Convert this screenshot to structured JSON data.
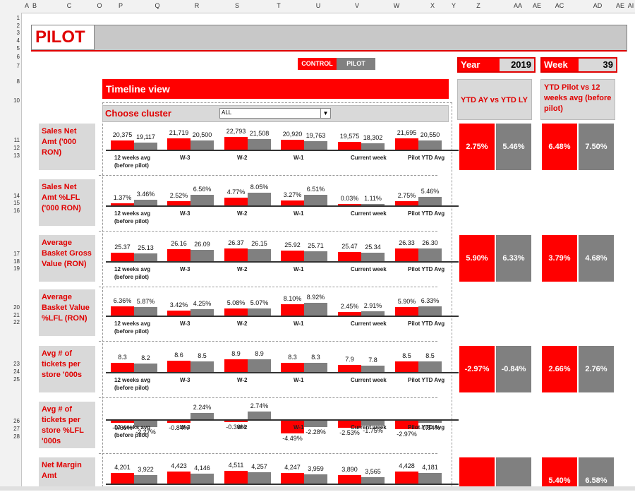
{
  "columns": [
    "A",
    "B",
    "C",
    "O",
    "P",
    "Q",
    "R",
    "S",
    "T",
    "U",
    "V",
    "W",
    "X",
    "Y",
    "Z",
    "AA",
    "AE",
    "AC",
    "AD",
    "AE",
    "AI"
  ],
  "rows": [
    "1",
    "2",
    "3",
    "4",
    "5",
    "6",
    "7",
    "8",
    "",
    "10",
    "11",
    "12",
    "13",
    "14",
    "15",
    "16",
    "17",
    "18",
    "19",
    "20",
    "21",
    "22",
    "23",
    "24",
    "25",
    "26",
    "27",
    "28"
  ],
  "title": "PILOT",
  "toggle": {
    "control": "CONTROL",
    "pilot": "PILOT"
  },
  "year": {
    "label": "Year",
    "value": "2019"
  },
  "week": {
    "label": "Week",
    "value": "39"
  },
  "timeline_title": "Timeline view",
  "cluster": {
    "label": "Choose cluster",
    "value": "ALL"
  },
  "ytd_headers": {
    "ay": "YTD AY vs YTD LY",
    "pilot": "YTD Pilot vs 12 weeks avg (before pilot)"
  },
  "colors": {
    "red": "#ff0000",
    "grey": "#808080"
  },
  "categories": [
    "12 weeks avg (before pilot)",
    "W-3",
    "W-2",
    "W-1",
    "Current week",
    "Pilot YTD Avg"
  ],
  "metrics": [
    {
      "label": "Sales Net Amt ('000 RON)",
      "control": [
        "20,375",
        "21,719",
        "22,793",
        "20,920",
        "19,575",
        "21,695"
      ],
      "pilot": [
        "19,117",
        "20,500",
        "21,508",
        "19,763",
        "18,302",
        "20,550"
      ],
      "kpi": [
        "2.75%",
        "5.46%",
        "6.48%",
        "7.50%"
      ]
    },
    {
      "label": "Sales Net Amt %LFL ('000 RON)",
      "control": [
        "1.37%",
        "2.52%",
        "4.77%",
        "3.27%",
        "0.03%",
        "2.75%"
      ],
      "pilot": [
        "3.46%",
        "6.56%",
        "8.05%",
        "6.51%",
        "1.11%",
        "5.46%"
      ]
    },
    {
      "label": "Average Basket Gross Value (RON)",
      "control": [
        "25.37",
        "26.16",
        "26.37",
        "25.92",
        "25.47",
        "26.33"
      ],
      "pilot": [
        "25.13",
        "26.09",
        "26.15",
        "25.71",
        "25.34",
        "26.30"
      ],
      "kpi": [
        "5.90%",
        "6.33%",
        "3.79%",
        "4.68%"
      ]
    },
    {
      "label": "Average Basket Value %LFL (RON)",
      "control": [
        "6.36%",
        "3.42%",
        "5.08%",
        "8.10%",
        "2.45%",
        "5.90%"
      ],
      "pilot": [
        "5.87%",
        "4.25%",
        "5.07%",
        "8.92%",
        "2.91%",
        "6.33%"
      ]
    },
    {
      "label": "Avg # of tickets per store '000s",
      "control": [
        "8.3",
        "8.6",
        "8.9",
        "8.3",
        "7.9",
        "8.5"
      ],
      "pilot": [
        "8.2",
        "8.5",
        "8.9",
        "8.3",
        "7.8",
        "8.5"
      ],
      "kpi": [
        "-2.97%",
        "-0.84%",
        "2.66%",
        "2.76%"
      ]
    },
    {
      "label": "Avg # of tickets per store %LFL '000s",
      "control": [
        "-0.69%",
        "-0.84%",
        "-0.36%",
        "-4.49%",
        "-2.53%",
        "-2.97%"
      ],
      "pilot": [
        "-2.27%",
        "2.24%",
        "2.74%",
        "-2.28%",
        "-1.75%",
        "-0.84%"
      ]
    },
    {
      "label": "Net Margin Amt",
      "control": [
        "4,201",
        "4,423",
        "4,511",
        "4,247",
        "3,890",
        "4,428"
      ],
      "pilot": [
        "3,922",
        "4,146",
        "4,257",
        "3,959",
        "3,565",
        "4,181"
      ],
      "kpi": [
        "",
        "",
        "5.40%",
        "6.58%"
      ]
    }
  ]
}
